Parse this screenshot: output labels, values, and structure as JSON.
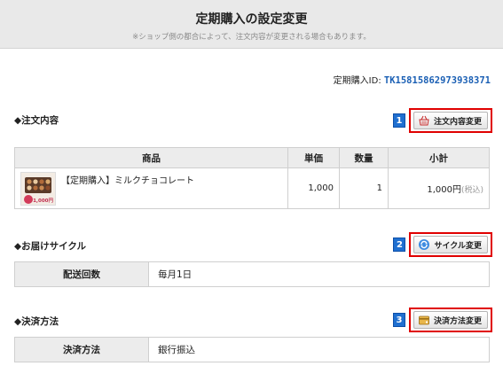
{
  "header": {
    "title": "定期購入の設定変更",
    "note": "※ショップ側の都合によって、注文内容が変更される場合もあります。"
  },
  "order_id": {
    "label": "定期購入ID:",
    "value": "TK15815862973938371"
  },
  "order_section": {
    "title": "◆注文内容",
    "button": {
      "badge": "1",
      "label": "注文内容変更",
      "icon": "basket-icon"
    },
    "columns": [
      "商品",
      "単価",
      "数量",
      "小計"
    ],
    "rows": [
      {
        "name": "【定期購入】ミルクチョコレート",
        "thumb_price": "1,000円",
        "unit_price": "1,000",
        "qty": "1",
        "subtotal": "1,000円",
        "tax": "(税込)"
      }
    ]
  },
  "delivery_section": {
    "title": "◆お届けサイクル",
    "button": {
      "badge": "2",
      "label": "サイクル変更",
      "icon": "refresh-icon"
    },
    "field_label": "配送回数",
    "field_value": "毎月1日"
  },
  "payment_section": {
    "title": "◆決済方法",
    "button": {
      "badge": "3",
      "label": "決済方法変更",
      "icon": "wallet-icon"
    },
    "field_label": "決済方法",
    "field_value": "銀行振込"
  },
  "colors": {
    "accent_blue": "#1a5fb4",
    "badge_blue": "#1f6fd0",
    "highlight_red": "#e00000"
  }
}
